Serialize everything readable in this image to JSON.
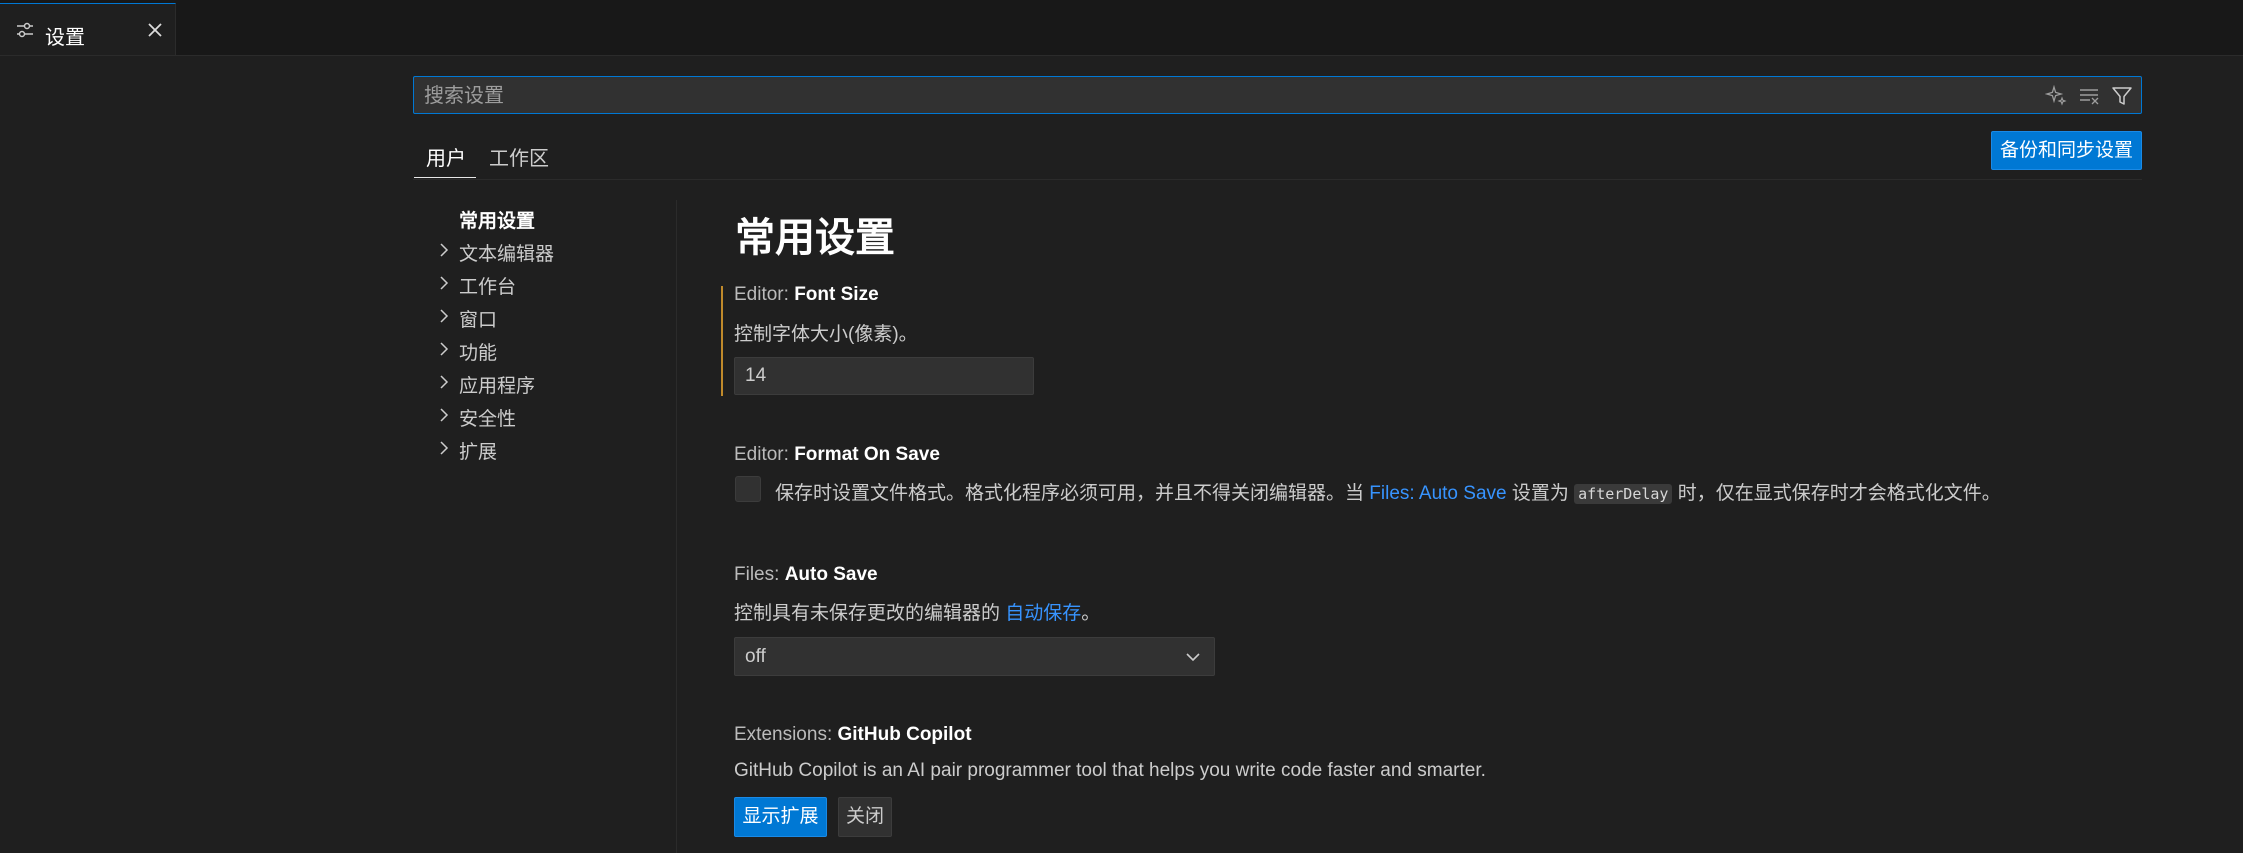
{
  "tab": {
    "label": "设置",
    "icon": "settings-sliders-icon"
  },
  "search": {
    "placeholder": "搜索设置",
    "value": ""
  },
  "scopes": {
    "user": "用户",
    "workspace": "工作区"
  },
  "sync_button": "备份和同步设置",
  "toc": [
    {
      "label": "常用设置",
      "active": true
    },
    {
      "label": "文本编辑器"
    },
    {
      "label": "工作台"
    },
    {
      "label": "窗口"
    },
    {
      "label": "功能"
    },
    {
      "label": "应用程序"
    },
    {
      "label": "安全性"
    },
    {
      "label": "扩展"
    }
  ],
  "section_title": "常用设置",
  "settings": {
    "font_size": {
      "category": "Editor: ",
      "key": "Font Size",
      "description": "控制字体大小(像素)。",
      "value": "14"
    },
    "format_on_save": {
      "category": "Editor: ",
      "key": "Format On Save",
      "desc_1": "保存时设置文件格式。格式化程序必须可用，并且不得关闭编辑器。当 ",
      "link": "Files: Auto Save",
      "desc_2": " 设置为 ",
      "code": "afterDelay",
      "desc_3": " 时，仅在显式保存时才会格式化文件。",
      "checked": false
    },
    "auto_save": {
      "category": "Files: ",
      "key": "Auto Save",
      "desc_1": "控制具有未保存更改的编辑器的 ",
      "link": "自动保存",
      "desc_2": "。",
      "value": "off"
    },
    "copilot": {
      "category": "Extensions: ",
      "key": "GitHub Copilot",
      "description": "GitHub Copilot is an AI pair programmer tool that helps you write code faster and smarter.",
      "show_button": "显示扩展",
      "close_button": "关闭"
    }
  },
  "colors": {
    "accent": "#0078d4",
    "link": "#3794ff",
    "modified": "#c08a2b",
    "background": "#1f1f1f"
  }
}
